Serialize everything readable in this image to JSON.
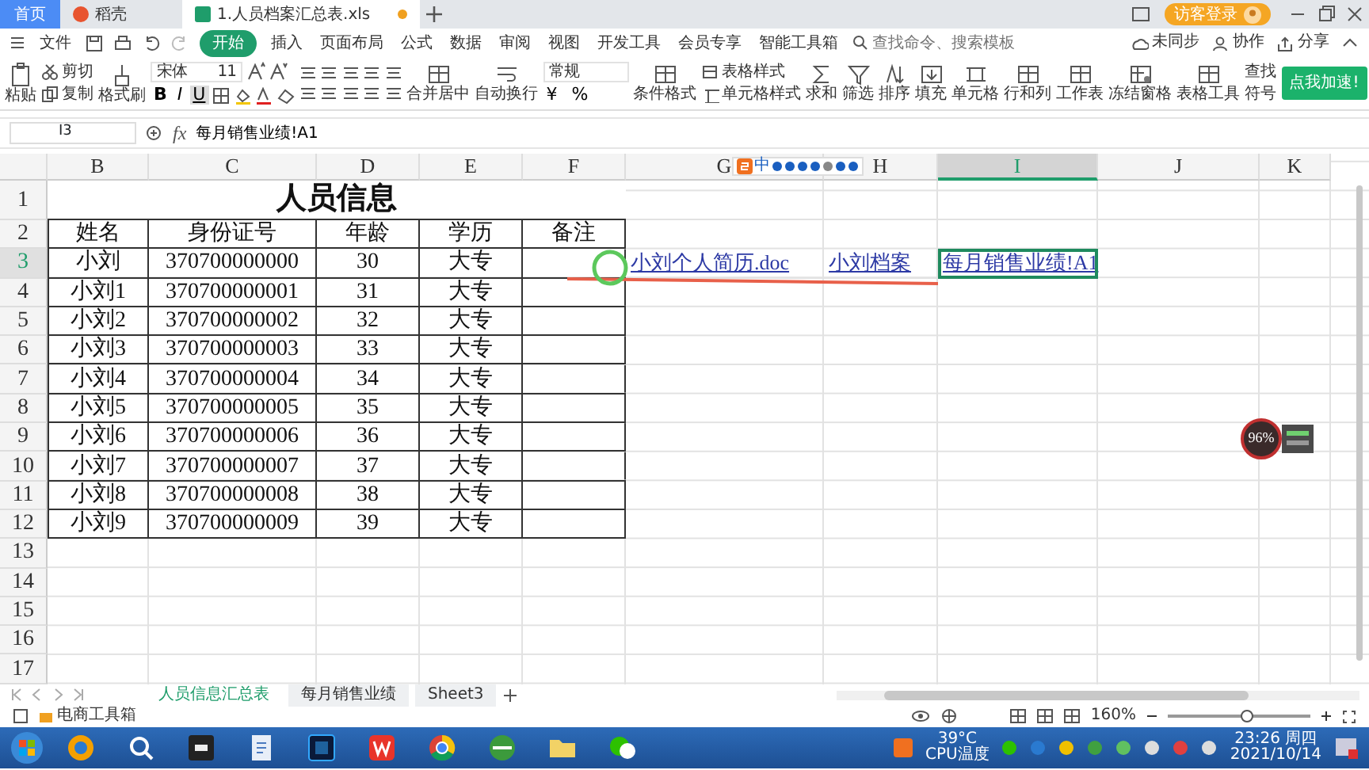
{
  "tabs": [
    {
      "label": "首页",
      "kind": "home",
      "selected": false
    },
    {
      "label": "稻壳",
      "kind": "docer",
      "selected": false
    },
    {
      "label": "1.人员档案汇总表.xls",
      "kind": "sheet",
      "selected": true
    }
  ],
  "account": {
    "label": "访客登录"
  },
  "menu": [
    {
      "label": "文件",
      "selected": false
    },
    {
      "label": "开始",
      "selected": true
    },
    {
      "label": "插入",
      "selected": false
    },
    {
      "label": "页面布局",
      "selected": false
    },
    {
      "label": "公式",
      "selected": false
    },
    {
      "label": "数据",
      "selected": false
    },
    {
      "label": "审阅",
      "selected": false
    },
    {
      "label": "视图",
      "selected": false
    },
    {
      "label": "开发工具",
      "selected": false
    },
    {
      "label": "会员专享",
      "selected": false
    },
    {
      "label": "智能工具箱",
      "selected": false
    }
  ],
  "search": {
    "placeholder": "查找命令、搜索模板"
  },
  "share_actions": [
    {
      "label": "未同步",
      "kind": "cloud"
    },
    {
      "label": "协作",
      "kind": "person"
    },
    {
      "label": "分享",
      "kind": "share"
    }
  ],
  "ribbon": {
    "paste": "粘贴",
    "cut": "剪切",
    "copy": "复制",
    "format_painter": "格式刷",
    "font": "宋体",
    "size": "11",
    "styles": [
      {
        "label": "B",
        "selected": false
      },
      {
        "label": "I",
        "selected": false
      },
      {
        "label": "U",
        "selected": true
      }
    ],
    "merge": "合并居中",
    "wrap": "自动换行",
    "number_format": "常规",
    "number_symbols": [
      "¥",
      "%"
    ],
    "style_stack": [
      {
        "label": "表格样式",
        "kind": "table"
      },
      {
        "label": "单元格样式",
        "kind": "cell"
      }
    ],
    "large": [
      {
        "label": "条件格式",
        "kind": "grid"
      },
      {
        "label": "求和",
        "kind": "sum"
      },
      {
        "label": "筛选",
        "kind": "funnel"
      },
      {
        "label": "排序",
        "kind": "sort"
      },
      {
        "label": "填充",
        "kind": "fill"
      },
      {
        "label": "单元格",
        "kind": "cell"
      },
      {
        "label": "行和列",
        "kind": "grid"
      },
      {
        "label": "工作表",
        "kind": "grid"
      },
      {
        "label": "冻结窗格",
        "kind": "freeze"
      },
      {
        "label": "表格工具",
        "kind": "grid"
      }
    ],
    "small": [
      {
        "label": "查找"
      },
      {
        "label": "符号"
      }
    ],
    "promo": "点我加速!"
  },
  "formula_bar": {
    "cell": "I3",
    "fx": "fx",
    "formula": "每月销售业绩!A1"
  },
  "sheet": {
    "columns": [
      {
        "label": "B",
        "selected": false
      },
      {
        "label": "C",
        "selected": false
      },
      {
        "label": "D",
        "selected": false
      },
      {
        "label": "E",
        "selected": false
      },
      {
        "label": "F",
        "selected": false
      },
      {
        "label": "G",
        "selected": false
      },
      {
        "label": "H",
        "selected": false
      },
      {
        "label": "I",
        "selected": true
      },
      {
        "label": "J",
        "selected": false
      },
      {
        "label": "K",
        "selected": false
      }
    ],
    "row_numbers": [
      {
        "label": "1",
        "selected": false
      },
      {
        "label": "2",
        "selected": false
      },
      {
        "label": "3",
        "selected": true
      },
      {
        "label": "4",
        "selected": false
      },
      {
        "label": "5",
        "selected": false
      },
      {
        "label": "6",
        "selected": false
      },
      {
        "label": "7",
        "selected": false
      },
      {
        "label": "8",
        "selected": false
      },
      {
        "label": "9",
        "selected": false
      },
      {
        "label": "10",
        "selected": false
      },
      {
        "label": "11",
        "selected": false
      },
      {
        "label": "12",
        "selected": false
      },
      {
        "label": "13",
        "selected": false
      },
      {
        "label": "14",
        "selected": false
      },
      {
        "label": "15",
        "selected": false
      },
      {
        "label": "16",
        "selected": false
      },
      {
        "label": "17",
        "selected": false
      }
    ],
    "title": "人员信息",
    "header": [
      "姓名",
      "身份证号",
      "年龄",
      "学历",
      "备注"
    ],
    "records": [
      [
        "小刘",
        "370700000000",
        "30",
        "大专"
      ],
      [
        "小刘1",
        "370700000001",
        "31",
        "大专"
      ],
      [
        "小刘2",
        "370700000002",
        "32",
        "大专"
      ],
      [
        "小刘3",
        "370700000003",
        "33",
        "大专"
      ],
      [
        "小刘4",
        "370700000004",
        "34",
        "大专"
      ],
      [
        "小刘5",
        "370700000005",
        "35",
        "大专"
      ],
      [
        "小刘6",
        "370700000006",
        "36",
        "大专"
      ],
      [
        "小刘7",
        "370700000007",
        "37",
        "大专"
      ],
      [
        "小刘8",
        "370700000008",
        "38",
        "大专"
      ],
      [
        "小刘9",
        "370700000009",
        "39",
        "大专"
      ]
    ],
    "links": [
      {
        "text": "小刘个人简历.doc",
        "selected": false
      },
      {
        "text": "小刘档案",
        "selected": false
      },
      {
        "text": "每月销售业绩!A1",
        "selected": true
      }
    ]
  },
  "ime": {
    "mode": "中"
  },
  "perf_widget": {
    "percent": "96%"
  },
  "sheet_tabs": [
    {
      "label": "人员信息汇总表",
      "selected": true
    },
    {
      "label": "每月销售业绩",
      "selected": false
    },
    {
      "label": "Sheet3",
      "selected": false
    }
  ],
  "status_bar": {
    "toolbox": "电商工具箱",
    "zoom": "160%",
    "zoom_level": {
      "level": 0.55
    }
  },
  "taskbar": {
    "temperature": "39°C",
    "temperature_label": "CPU温度",
    "time": "23:26 周四",
    "date": "2021/10/14"
  }
}
